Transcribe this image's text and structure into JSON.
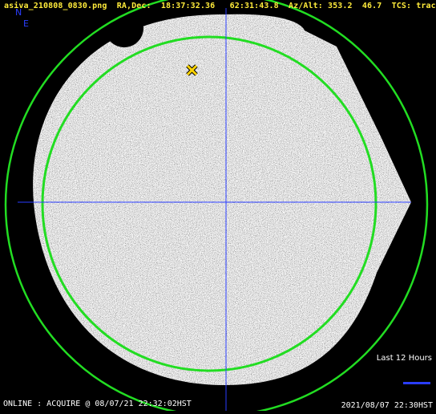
{
  "header": {
    "filename": "asiva_210808_0830.png",
    "radec_label": "RA,Dec:",
    "ra": "18:37:32.36",
    "dec": "62:31:43.8",
    "azalt_label": "Az/Alt:",
    "az": "353.2",
    "alt": "46.7",
    "tcs_label": "TCS:",
    "tcs_state": "track"
  },
  "directions": {
    "north": "N",
    "east": "E"
  },
  "legend": {
    "label": "Last 12 Hours"
  },
  "status": {
    "left": "ONLINE : ACQUIRE @ 08/07/21 22:32:02HST",
    "right": "2021/08/07 22:30HST"
  },
  "colors": {
    "header_text": "#ffeb3b",
    "direction_labels": "#2a3dff",
    "circles": "#22dd22",
    "crosshair": "#2a3dff",
    "target_marker": "#ffd400",
    "legend_bar": "#2a3dff",
    "background": "#000000"
  },
  "icons": {
    "target": "x-marker-icon"
  }
}
